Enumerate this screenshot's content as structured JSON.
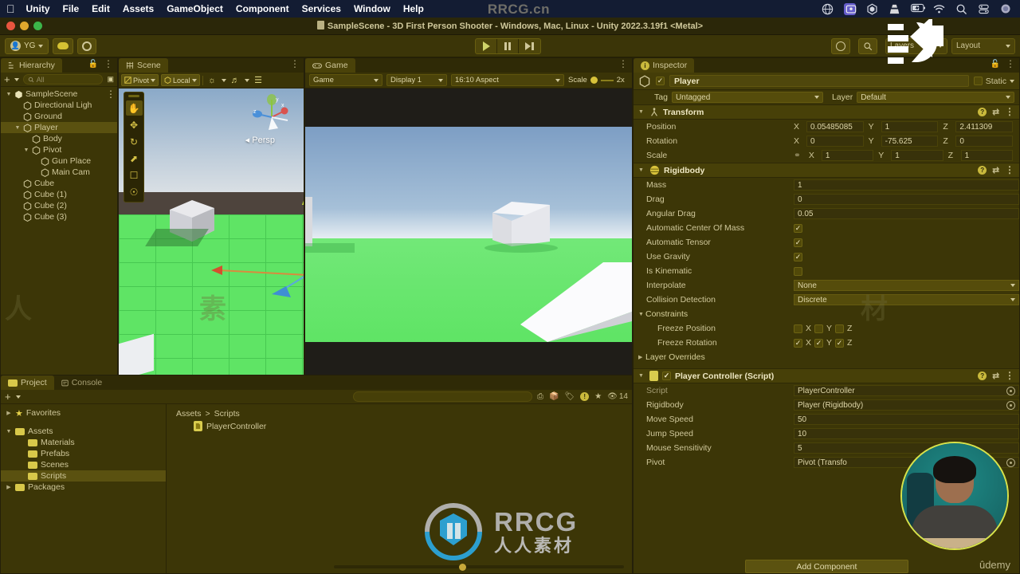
{
  "macos_menubar": {
    "apple_logo": "apple-icon",
    "items": [
      "Unity",
      "File",
      "Edit",
      "Assets",
      "GameObject",
      "Component",
      "Services",
      "Window",
      "Help"
    ],
    "tray_icons": [
      "globe-icon",
      "screen-share-icon",
      "unity-hub-icon",
      "vlc-icon",
      "battery-icon",
      "wifi-icon",
      "search-icon",
      "control-center-icon",
      "siri-icon"
    ],
    "watermark": "RRCG.cn"
  },
  "window": {
    "title": "SampleScene - 3D First Person Shooter - Windows, Mac, Linux - Unity 2022.3.19f1 <Metal>",
    "traffic_lights": [
      "close",
      "minimize",
      "zoom"
    ]
  },
  "toolbar": {
    "account_label": "YG",
    "cloud_icon": "cloud-icon",
    "settings_icon": "gear-icon",
    "play_icon": "play-icon",
    "pause_icon": "pause-icon",
    "step_icon": "step-icon",
    "history_icon": "history-icon",
    "search_icon": "search-icon",
    "layers_label": "Layers",
    "layout_label": "Layout"
  },
  "hierarchy": {
    "tab_label": "Hierarchy",
    "lock_icon": "lock-icon",
    "menu_icon": "kebab-icon",
    "add_icon": "plus-icon",
    "search_placeholder": "All",
    "items": [
      {
        "label": "SampleScene",
        "depth": 0,
        "arrow": "▼",
        "icon": "scene-icon",
        "selected": false
      },
      {
        "label": "Directional Ligh",
        "depth": 1,
        "arrow": "",
        "icon": "gameobject-icon",
        "selected": false
      },
      {
        "label": "Ground",
        "depth": 1,
        "arrow": "",
        "icon": "gameobject-icon",
        "selected": false
      },
      {
        "label": "Player",
        "depth": 1,
        "arrow": "▼",
        "icon": "gameobject-icon",
        "selected": true
      },
      {
        "label": "Body",
        "depth": 2,
        "arrow": "",
        "icon": "gameobject-icon",
        "selected": false
      },
      {
        "label": "Pivot",
        "depth": 2,
        "arrow": "▼",
        "icon": "gameobject-icon",
        "selected": false
      },
      {
        "label": "Gun Place",
        "depth": 3,
        "arrow": "",
        "icon": "gameobject-icon",
        "selected": false
      },
      {
        "label": "Main Cam",
        "depth": 3,
        "arrow": "",
        "icon": "gameobject-icon",
        "selected": false
      },
      {
        "label": "Cube",
        "depth": 1,
        "arrow": "",
        "icon": "gameobject-icon",
        "selected": false
      },
      {
        "label": "Cube (1)",
        "depth": 1,
        "arrow": "",
        "icon": "gameobject-icon",
        "selected": false
      },
      {
        "label": "Cube (2)",
        "depth": 1,
        "arrow": "",
        "icon": "gameobject-icon",
        "selected": false
      },
      {
        "label": "Cube (3)",
        "depth": 1,
        "arrow": "",
        "icon": "gameobject-icon",
        "selected": false
      }
    ]
  },
  "scene": {
    "tab_label": "Scene",
    "pivot_label": "Pivot",
    "local_label": "Local",
    "viewport_label": "Persp",
    "gizmo_axes": [
      "x",
      "y",
      "z"
    ],
    "tools": [
      "hand-tool",
      "move-tool",
      "rotate-tool",
      "scale-tool",
      "rect-tool",
      "transform-tool"
    ]
  },
  "game": {
    "tab_label": "Game",
    "mode_label": "Game",
    "display_label": "Display 1",
    "aspect_label": "16:10 Aspect",
    "scale_label": "Scale",
    "scale_value": "2x"
  },
  "project": {
    "tab_label": "Project",
    "console_tab_label": "Console",
    "add_icon": "plus-icon",
    "search_placeholder": "",
    "warning_count": "14",
    "tree": [
      {
        "label": "Favorites",
        "depth": 0,
        "arrow": "▶",
        "icon": "star-icon",
        "selected": false
      },
      {
        "label": "Assets",
        "depth": 0,
        "arrow": "▼",
        "icon": "folder-icon",
        "selected": false
      },
      {
        "label": "Materials",
        "depth": 1,
        "arrow": "",
        "icon": "folder-icon",
        "selected": false
      },
      {
        "label": "Prefabs",
        "depth": 1,
        "arrow": "",
        "icon": "folder-icon",
        "selected": false
      },
      {
        "label": "Scenes",
        "depth": 1,
        "arrow": "",
        "icon": "folder-icon",
        "selected": false
      },
      {
        "label": "Scripts",
        "depth": 1,
        "arrow": "",
        "icon": "folder-icon",
        "selected": true
      },
      {
        "label": "Packages",
        "depth": 0,
        "arrow": "▶",
        "icon": "folder-icon",
        "selected": false
      }
    ],
    "breadcrumb": [
      "Assets",
      "Scripts"
    ],
    "assets": [
      {
        "label": "PlayerController",
        "icon": "cs-script-icon"
      }
    ]
  },
  "inspector": {
    "tab_label": "Inspector",
    "lock_icon": "lock-icon",
    "menu_icon": "kebab-icon",
    "object_name": "Player",
    "object_enabled": true,
    "static_label": "Static",
    "tag_label": "Tag",
    "tag_value": "Untagged",
    "layer_label": "Layer",
    "layer_value": "Default",
    "components": [
      {
        "name": "Transform",
        "icon": "transform-icon",
        "vectors": [
          {
            "label": "Position",
            "x": "0.05485085",
            "y": "1",
            "z": "2.411309"
          },
          {
            "label": "Rotation",
            "x": "0",
            "y": "-75.625",
            "z": "0"
          },
          {
            "label": "Scale",
            "x": "1",
            "y": "1",
            "z": "1",
            "link_icon": "constrain-proportions-icon"
          }
        ]
      },
      {
        "name": "Rigidbody",
        "icon": "rigidbody-icon",
        "fields": [
          {
            "label": "Mass",
            "type": "text",
            "value": "1"
          },
          {
            "label": "Drag",
            "type": "text",
            "value": "0"
          },
          {
            "label": "Angular Drag",
            "type": "text",
            "value": "0.05"
          },
          {
            "label": "Automatic Center Of Mass",
            "type": "check",
            "value": true
          },
          {
            "label": "Automatic Tensor",
            "type": "check",
            "value": true
          },
          {
            "label": "Use Gravity",
            "type": "check",
            "value": true
          },
          {
            "label": "Is Kinematic",
            "type": "check",
            "value": false
          },
          {
            "label": "Interpolate",
            "type": "dropdown",
            "value": "None"
          },
          {
            "label": "Collision Detection",
            "type": "dropdown",
            "value": "Discrete"
          },
          {
            "label": "Constraints",
            "type": "foldout",
            "value": ""
          },
          {
            "label": "Freeze Position",
            "type": "axes",
            "axes": [
              "X",
              "Y",
              "Z"
            ],
            "checked": [
              false,
              false,
              false
            ]
          },
          {
            "label": "Freeze Rotation",
            "type": "axes",
            "axes": [
              "X",
              "Y",
              "Z"
            ],
            "checked": [
              true,
              true,
              true
            ]
          },
          {
            "label": "Layer Overrides",
            "type": "foldout-collapsed",
            "value": ""
          }
        ]
      },
      {
        "name": "Player Controller (Script)",
        "icon": "cs-script-icon",
        "enabled": true,
        "fields": [
          {
            "label": "Script",
            "type": "object",
            "value": "PlayerController",
            "dim": true
          },
          {
            "label": "Rigidbody",
            "type": "object",
            "value": "Player (Rigidbody)"
          },
          {
            "label": "Move Speed",
            "type": "text",
            "value": "50"
          },
          {
            "label": "Jump Speed",
            "type": "text",
            "value": "10"
          },
          {
            "label": "Mouse Sensitivity",
            "type": "text",
            "value": "5"
          },
          {
            "label": "Pivot",
            "type": "object",
            "value": "Pivot (Transfo"
          }
        ]
      }
    ],
    "add_component_label": "Add Component"
  },
  "overlays": {
    "webcam": "presenter-webcam",
    "watermark_en": "RRCG",
    "watermark_cn": "人人素材",
    "udemy_label": "ûdemy",
    "faint_marks": [
      "人",
      "人",
      "素",
      "材",
      "RRCG",
      "RRCG"
    ]
  },
  "colors": {
    "accent_yellow": "#d6c233",
    "panel_bg": "#3c3607",
    "selection": "#5a5110",
    "webcam_ring": "#d8e24a"
  }
}
